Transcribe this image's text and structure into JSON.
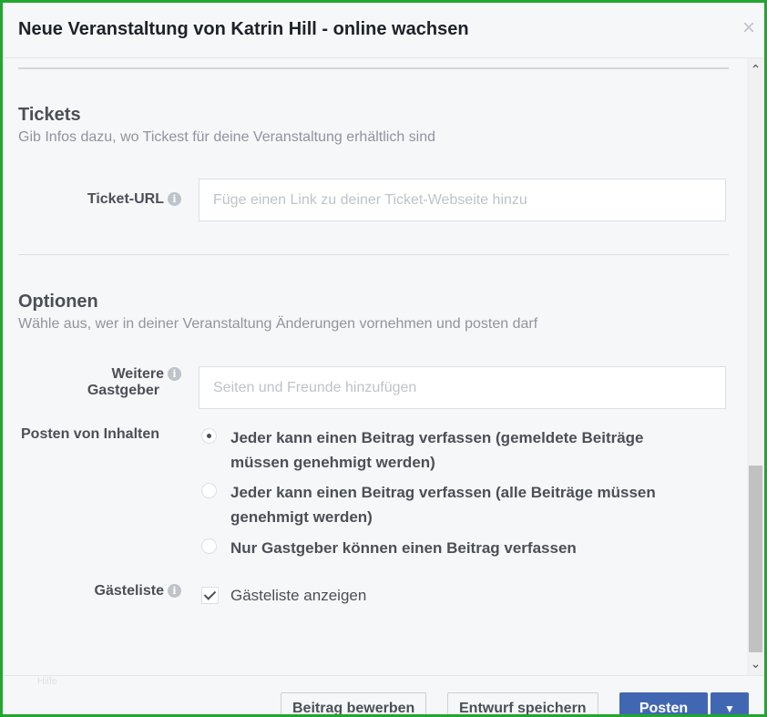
{
  "dialog": {
    "title": "Neue Veranstaltung von Katrin Hill - online wachsen",
    "close_glyph": "×"
  },
  "tickets": {
    "title": "Tickets",
    "subtitle": "Gib Infos dazu, wo Tickest für deine Veranstaltung erhältlich sind",
    "url_label": "Ticket-URL",
    "url_placeholder": "Füge einen Link zu deiner Ticket-Webseite hinzu",
    "url_value": ""
  },
  "options": {
    "title": "Optionen",
    "subtitle": "Wähle aus, wer in deiner Veranstaltung Änderungen vornehmen und posten darf",
    "hosts_label_line1": "Weitere",
    "hosts_label_line2": "Gastgeber",
    "hosts_placeholder": "Seiten und Freunde hinzufügen",
    "posting_label": "Posten von Inhalten",
    "posting_options": [
      {
        "label": "Jeder kann einen Beitrag verfassen (gemeldete Beiträge müssen genehmigt werden)",
        "selected": true
      },
      {
        "label": "Jeder kann einen Beitrag verfassen (alle Beiträge müssen genehmigt werden)",
        "selected": false
      },
      {
        "label": "Nur Gastgeber können einen Beitrag verfassen",
        "selected": false
      }
    ],
    "guestlist_label": "Gästeliste",
    "guestlist_checkbox_label": "Gästeliste anzeigen",
    "guestlist_checked": true
  },
  "footer": {
    "faint_text": "Hilfe",
    "promote_label": "Beitrag bewerben",
    "draft_label": "Entwurf speichern",
    "post_label": "Posten",
    "dropdown_glyph": "▼"
  },
  "icons": {
    "info": "i",
    "scroll_up": "⌃",
    "scroll_down": "⌄"
  },
  "colors": {
    "frame_border": "#22a531",
    "primary_button": "#4267b2",
    "background": "#f6f7f9"
  }
}
